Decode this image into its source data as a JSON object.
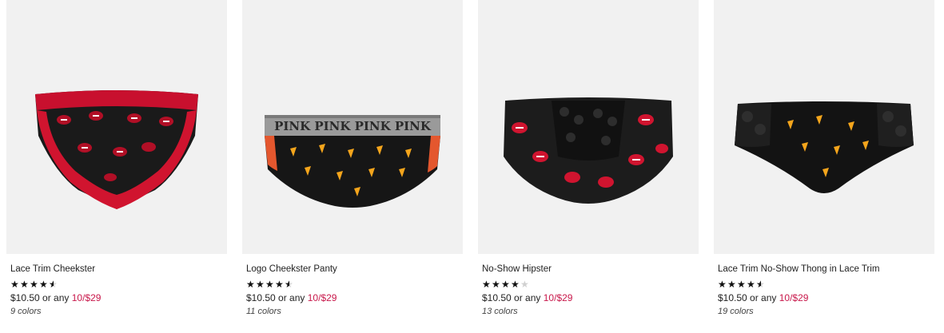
{
  "products": [
    {
      "name": "Lace Trim Cheekster",
      "rating": 4.5,
      "price": "$10.50",
      "price_connector": "or any",
      "promo": "10/$29",
      "colors": "9 colors",
      "image_icon": "red-lace-cheekster-image"
    },
    {
      "name": "Logo Cheekster Panty",
      "rating": 4.5,
      "price": "$10.50",
      "price_connector": "or any",
      "promo": "10/$29",
      "colors": "11 colors",
      "waistband_text": "PINK PINK PINK PINK",
      "image_icon": "logo-cheekster-image"
    },
    {
      "name": "No-Show Hipster",
      "rating": 4.0,
      "price": "$10.50",
      "price_connector": "or any",
      "promo": "10/$29",
      "colors": "13 colors",
      "image_icon": "no-show-hipster-image"
    },
    {
      "name": "Lace Trim No-Show Thong in Lace Trim",
      "rating": 4.5,
      "price": "$10.50",
      "price_connector": "or any",
      "promo": "10/$29",
      "colors": "19 colors",
      "image_icon": "lace-thong-image"
    }
  ],
  "theme": {
    "promo_color": "#c8174a",
    "star_color": "#111111",
    "star_empty_color": "#d0d0d0",
    "thumb_bg": "#f1f1f1"
  }
}
